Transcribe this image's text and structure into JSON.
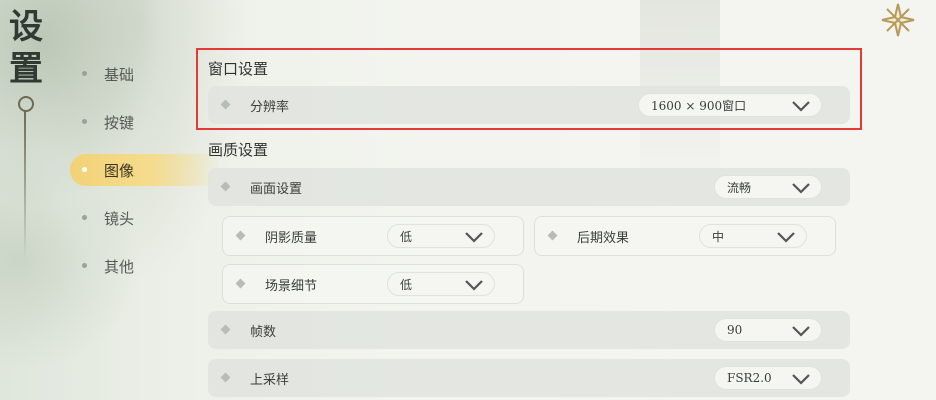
{
  "page": {
    "title_chars": [
      "设",
      "置"
    ]
  },
  "sidebar": {
    "items": [
      {
        "label": "基础",
        "active": false
      },
      {
        "label": "按键",
        "active": false
      },
      {
        "label": "图像",
        "active": true
      },
      {
        "label": "镜头",
        "active": false
      },
      {
        "label": "其他",
        "active": false
      }
    ]
  },
  "window_settings": {
    "title": "窗口设置",
    "resolution": {
      "label": "分辨率",
      "value": "1600 × 900窗口"
    }
  },
  "quality_settings": {
    "title": "画质设置",
    "preset": {
      "label": "画面设置",
      "value": "流畅"
    },
    "shadow": {
      "label": "阴影质量",
      "value": "低"
    },
    "post": {
      "label": "后期效果",
      "value": "中"
    },
    "scene": {
      "label": "场景细节",
      "value": "低"
    },
    "fps": {
      "label": "帧数",
      "value": "90"
    },
    "upscale": {
      "label": "上采样",
      "value": "FSR2.0"
    }
  },
  "icons": {
    "corner": "flower-star-icon",
    "dropdown": "chevron-down-icon",
    "bullet": "diamond-bullet-icon"
  },
  "colors": {
    "active_tab": "#f2d277",
    "highlight_border": "#e53935"
  }
}
